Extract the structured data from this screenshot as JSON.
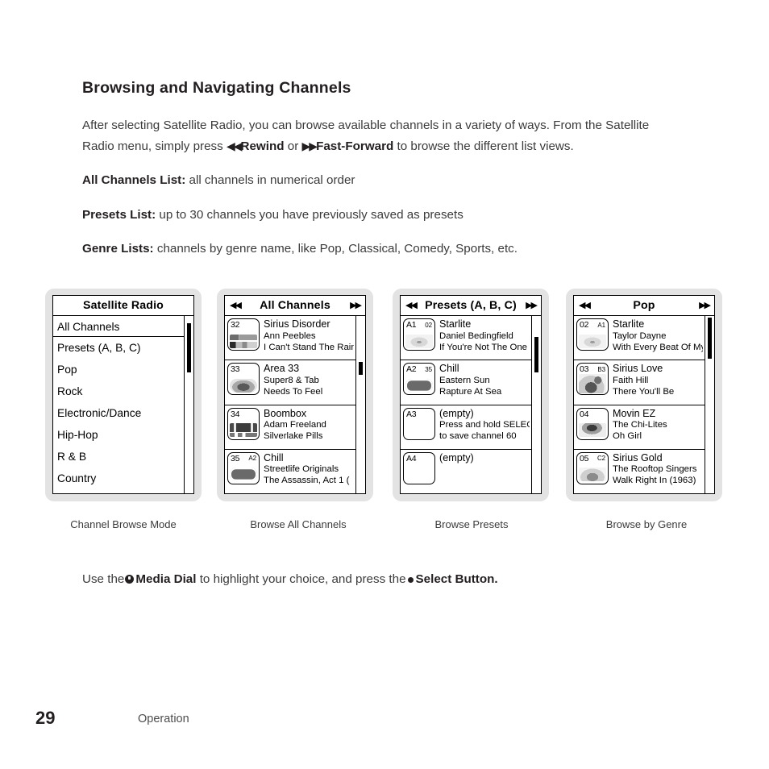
{
  "section": {
    "title": "Browsing and Navigating Channels",
    "paragraphs": {
      "intro_a": "After selecting Satellite Radio, you can browse available channels in a variety of ways. From the Satellite Radio menu, simply press",
      "rewind_glyph": "◀◀",
      "rewind_label": "Rewind",
      "or": "or",
      "ff_glyph": "▶▶",
      "ff_label": "Fast-Forward",
      "intro_b": "to browse the different list views."
    },
    "definitions": [
      {
        "term": "All Channels List:",
        "desc": "all channels in numerical order"
      },
      {
        "term": "Presets List:",
        "desc": "up to 30 channels you have previously saved as presets"
      },
      {
        "term": "Genre Lists:",
        "desc": "channels by genre name, like Pop, Classical, Comedy, Sports, etc."
      }
    ]
  },
  "devices": [
    {
      "caption": "Channel Browse Mode",
      "screen_type": "menu",
      "title": "Satellite Radio",
      "nav_left": "",
      "nav_right": "",
      "menu_items": [
        {
          "label": "All Channels",
          "selected": true
        },
        {
          "label": "Presets (A, B, C)",
          "selected": false
        },
        {
          "label": "Pop",
          "selected": false
        },
        {
          "label": "Rock",
          "selected": false
        },
        {
          "label": "Electronic/Dance",
          "selected": false
        },
        {
          "label": "Hip-Hop",
          "selected": false
        },
        {
          "label": "R & B",
          "selected": false
        },
        {
          "label": "Country",
          "selected": false
        }
      ],
      "scrollbar": {
        "top_pct": 4,
        "height_pct": 28
      }
    },
    {
      "caption": "Browse All Channels",
      "screen_type": "channels",
      "title": "All Channels",
      "nav_left": "◀◀",
      "nav_right": "▶▶",
      "rows": [
        {
          "num": "32",
          "sub": "",
          "art": "sirius-disorder",
          "line1": "Sirius Disorder",
          "line2": "Ann Peebles",
          "line3": "I Can't Stand The Rain"
        },
        {
          "num": "33",
          "sub": "",
          "art": "area33",
          "line1": "Area 33",
          "line2": "Super8 & Tab",
          "line3": "Needs To Feel"
        },
        {
          "num": "34",
          "sub": "",
          "art": "boombox",
          "line1": "Boombox",
          "line2": "Adam Freeland",
          "line3": "Silverlake Pills"
        },
        {
          "num": "35",
          "sub": "A2",
          "art": "chill",
          "line1": "Chill",
          "line2": "Streetlife Originals",
          "line3": "The Assassin, Act 1 ("
        }
      ],
      "scrollbar": {
        "top_pct": 26,
        "height_pct": 7
      }
    },
    {
      "caption": "Browse Presets",
      "screen_type": "channels",
      "title": "Presets (A, B, C)",
      "nav_left": "◀◀",
      "nav_right": "▶▶",
      "rows": [
        {
          "num": "A1",
          "sub": "02",
          "art": "starlite",
          "line1": "Starlite",
          "line2": "Daniel Bedingfield",
          "line3": "If You're Not The One"
        },
        {
          "num": "A2",
          "sub": "35",
          "art": "chill",
          "line1": "Chill",
          "line2": "Eastern Sun",
          "line3": "Rapture At Sea"
        },
        {
          "num": "A3",
          "sub": "",
          "art": "empty",
          "line1": "(empty)",
          "line2": "Press and hold SELECT",
          "line3": "to save channel 60"
        },
        {
          "num": "A4",
          "sub": "",
          "art": "empty",
          "line1": "(empty)",
          "line2": "",
          "line3": ""
        }
      ],
      "scrollbar": {
        "top_pct": 12,
        "height_pct": 20
      }
    },
    {
      "caption": "Browse by Genre",
      "screen_type": "channels",
      "title": "Pop",
      "nav_left": "◀◀",
      "nav_right": "▶▶",
      "rows": [
        {
          "num": "02",
          "sub": "A1",
          "art": "starlite",
          "line1": "Starlite",
          "line2": "Taylor Dayne",
          "line3": "With Every Beat Of My L"
        },
        {
          "num": "03",
          "sub": "B3",
          "art": "siriuslove",
          "line1": "Sirius Love",
          "line2": "Faith Hill",
          "line3": "There You'll Be"
        },
        {
          "num": "04",
          "sub": "",
          "art": "movinez",
          "line1": "Movin EZ",
          "line2": "The Chi-Lites",
          "line3": "Oh Girl"
        },
        {
          "num": "05",
          "sub": "C2",
          "art": "siriusgold",
          "line1": "Sirius Gold",
          "line2": "The Rooftop Singers",
          "line3": "Walk Right In (1963)"
        }
      ],
      "scrollbar": {
        "top_pct": 1,
        "height_pct": 23
      }
    }
  ],
  "use_line": {
    "pre": "Use the",
    "dial_label": "Media Dial",
    "mid": "to highlight your choice, and press the",
    "select_label": "Select Button",
    "period": "."
  },
  "footer": {
    "page_number": "29",
    "label": "Operation"
  }
}
